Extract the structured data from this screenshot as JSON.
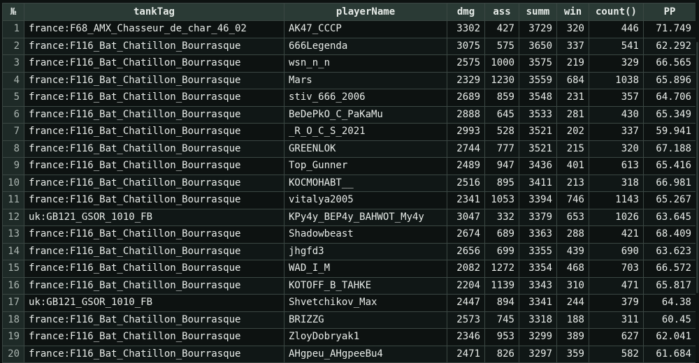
{
  "table": {
    "columns": [
      "№",
      "tankTag",
      "playerName",
      "dmg",
      "ass",
      "summ",
      "win",
      "count()",
      "PP"
    ],
    "rows": [
      [
        "1",
        "france:F68_AMX_Chasseur_de_char_46_02",
        "AK47_CCCP",
        "3302",
        "427",
        "3729",
        "320",
        "446",
        "71.749"
      ],
      [
        "2",
        "france:F116_Bat_Chatillon_Bourrasque",
        "666Legenda",
        "3075",
        "575",
        "3650",
        "337",
        "541",
        "62.292"
      ],
      [
        "3",
        "france:F116_Bat_Chatillon_Bourrasque",
        "wsn_n_n",
        "2575",
        "1000",
        "3575",
        "219",
        "329",
        "66.565"
      ],
      [
        "4",
        "france:F116_Bat_Chatillon_Bourrasque",
        "Mars",
        "2329",
        "1230",
        "3559",
        "684",
        "1038",
        "65.896"
      ],
      [
        "5",
        "france:F116_Bat_Chatillon_Bourrasque",
        "stiv_666_2006",
        "2689",
        "859",
        "3548",
        "231",
        "357",
        "64.706"
      ],
      [
        "6",
        "france:F116_Bat_Chatillon_Bourrasque",
        "BeDePkO_C_PaKaMu",
        "2888",
        "645",
        "3533",
        "281",
        "430",
        "65.349"
      ],
      [
        "7",
        "france:F116_Bat_Chatillon_Bourrasque",
        "_R_O_C_S_2021",
        "2993",
        "528",
        "3521",
        "202",
        "337",
        "59.941"
      ],
      [
        "8",
        "france:F116_Bat_Chatillon_Bourrasque",
        "GREENLOK",
        "2744",
        "777",
        "3521",
        "215",
        "320",
        "67.188"
      ],
      [
        "9",
        "france:F116_Bat_Chatillon_Bourrasque",
        "Top_Gunner",
        "2489",
        "947",
        "3436",
        "401",
        "613",
        "65.416"
      ],
      [
        "10",
        "france:F116_Bat_Chatillon_Bourrasque",
        "KOCMOHABT__",
        "2516",
        "895",
        "3411",
        "213",
        "318",
        "66.981"
      ],
      [
        "11",
        "france:F116_Bat_Chatillon_Bourrasque",
        "vitalya2005",
        "2341",
        "1053",
        "3394",
        "746",
        "1143",
        "65.267"
      ],
      [
        "12",
        "uk:GB121_GSOR_1010_FB",
        "KPy4y_BEP4y_BAHWOT_My4y",
        "3047",
        "332",
        "3379",
        "653",
        "1026",
        "63.645"
      ],
      [
        "13",
        "france:F116_Bat_Chatillon_Bourrasque",
        "Shadowbeast",
        "2674",
        "689",
        "3363",
        "288",
        "421",
        "68.409"
      ],
      [
        "14",
        "france:F116_Bat_Chatillon_Bourrasque",
        "jhgfd3",
        "2656",
        "699",
        "3355",
        "439",
        "690",
        "63.623"
      ],
      [
        "15",
        "france:F116_Bat_Chatillon_Bourrasque",
        "WAD_I_M",
        "2082",
        "1272",
        "3354",
        "468",
        "703",
        "66.572"
      ],
      [
        "16",
        "france:F116_Bat_Chatillon_Bourrasque",
        "KOTOFF_B_TAHKE",
        "2204",
        "1139",
        "3343",
        "310",
        "471",
        "65.817"
      ],
      [
        "17",
        "uk:GB121_GSOR_1010_FB",
        "Shvetchikov_Max",
        "2447",
        "894",
        "3341",
        "244",
        "379",
        "64.38"
      ],
      [
        "18",
        "france:F116_Bat_Chatillon_Bourrasque",
        "BRIZZG",
        "2573",
        "745",
        "3318",
        "188",
        "311",
        "60.45"
      ],
      [
        "19",
        "france:F116_Bat_Chatillon_Bourrasque",
        "ZloyDobryak1",
        "2346",
        "953",
        "3299",
        "389",
        "627",
        "62.041"
      ],
      [
        "20",
        "france:F116_Bat_Chatillon_Bourrasque",
        "AHgpeu_AHgpeeBu4",
        "2471",
        "826",
        "3297",
        "359",
        "582",
        "61.684"
      ]
    ]
  }
}
